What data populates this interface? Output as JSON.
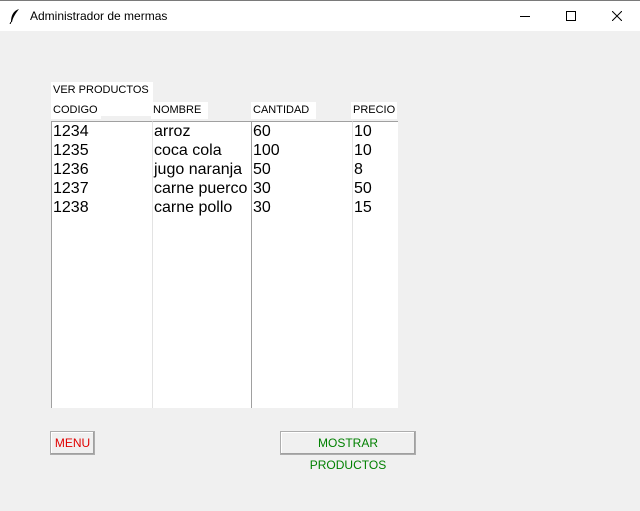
{
  "window": {
    "title": "Administrador de mermas",
    "icons": {
      "app": "feather-icon",
      "minimize": "minimize-icon",
      "maximize": "maximize-icon",
      "close": "close-icon"
    }
  },
  "section": {
    "label": "VER PRODUCTOS :"
  },
  "table": {
    "headers": [
      "CODIGO",
      "NOMBRE",
      "CANTIDAD",
      "PRECIO"
    ],
    "codigo": [
      "1234",
      "1235",
      "1236",
      "1237",
      "1238"
    ],
    "nombre": [
      "arroz",
      "coca cola",
      "jugo naranja",
      "carne puerco",
      "carne pollo"
    ],
    "cantidad": [
      "60",
      "100",
      "50",
      "30",
      "30"
    ],
    "precio": [
      "10",
      "10",
      "8",
      "50",
      "15"
    ]
  },
  "buttons": {
    "menu": "MENU",
    "mostrar": "MOSTRAR PRODUCTOS"
  },
  "colors": {
    "menu_text": "#e00000",
    "mostrar_text": "#008000"
  }
}
